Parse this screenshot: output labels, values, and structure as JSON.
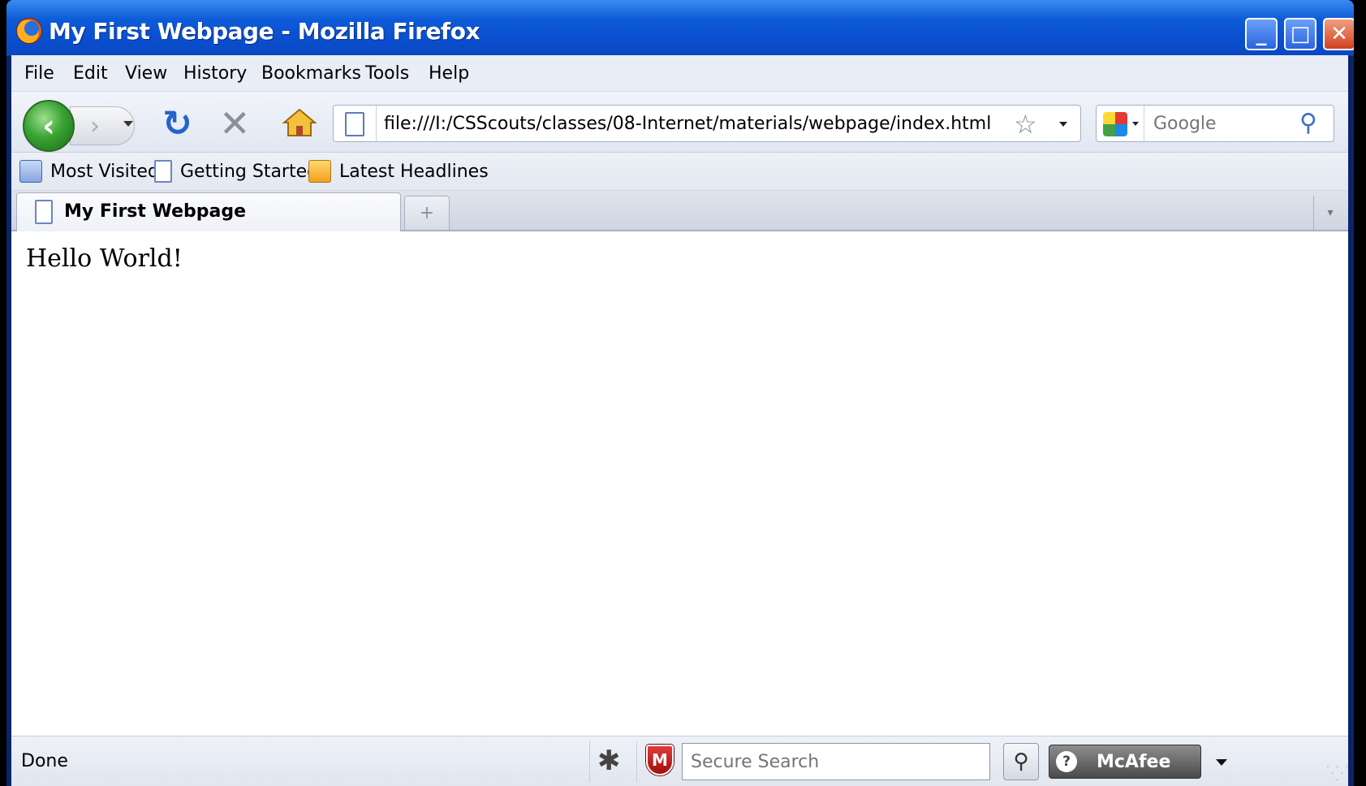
{
  "window": {
    "title": "My First Webpage - Mozilla Firefox",
    "minimize_label": "_",
    "maximize_label": "□",
    "close_label": "✕"
  },
  "menu": {
    "items": [
      "File",
      "Edit",
      "View",
      "History",
      "Bookmarks",
      "Tools",
      "Help"
    ]
  },
  "navbar": {
    "back_label": "‹",
    "forward_label": "›",
    "reload_label": "↻",
    "stop_label": "✕",
    "url": "file:///I:/CSScouts/classes/08-Internet/materials/webpage/index.html",
    "star_label": "☆",
    "search_placeholder": "Google",
    "search_mag_label": "⚲"
  },
  "bookmarks": {
    "items": [
      "Most Visited",
      "Getting Started",
      "Latest Headlines"
    ]
  },
  "tabs": {
    "active_label": "My First Webpage",
    "new_tab_label": "+",
    "all_tabs_label": "▾"
  },
  "content": {
    "text": "Hello World!"
  },
  "statusbar": {
    "status": "Done",
    "bug_label": "✱",
    "shield_label": "M",
    "secure_search_placeholder": "Secure Search",
    "search_btn_label": "⚲",
    "mcafee_label": "McAfee",
    "mcafee_q": "?"
  },
  "colors": {
    "titlebar": "#0a4fd0",
    "back_button": "#39a333",
    "reload": "#2563c9"
  }
}
